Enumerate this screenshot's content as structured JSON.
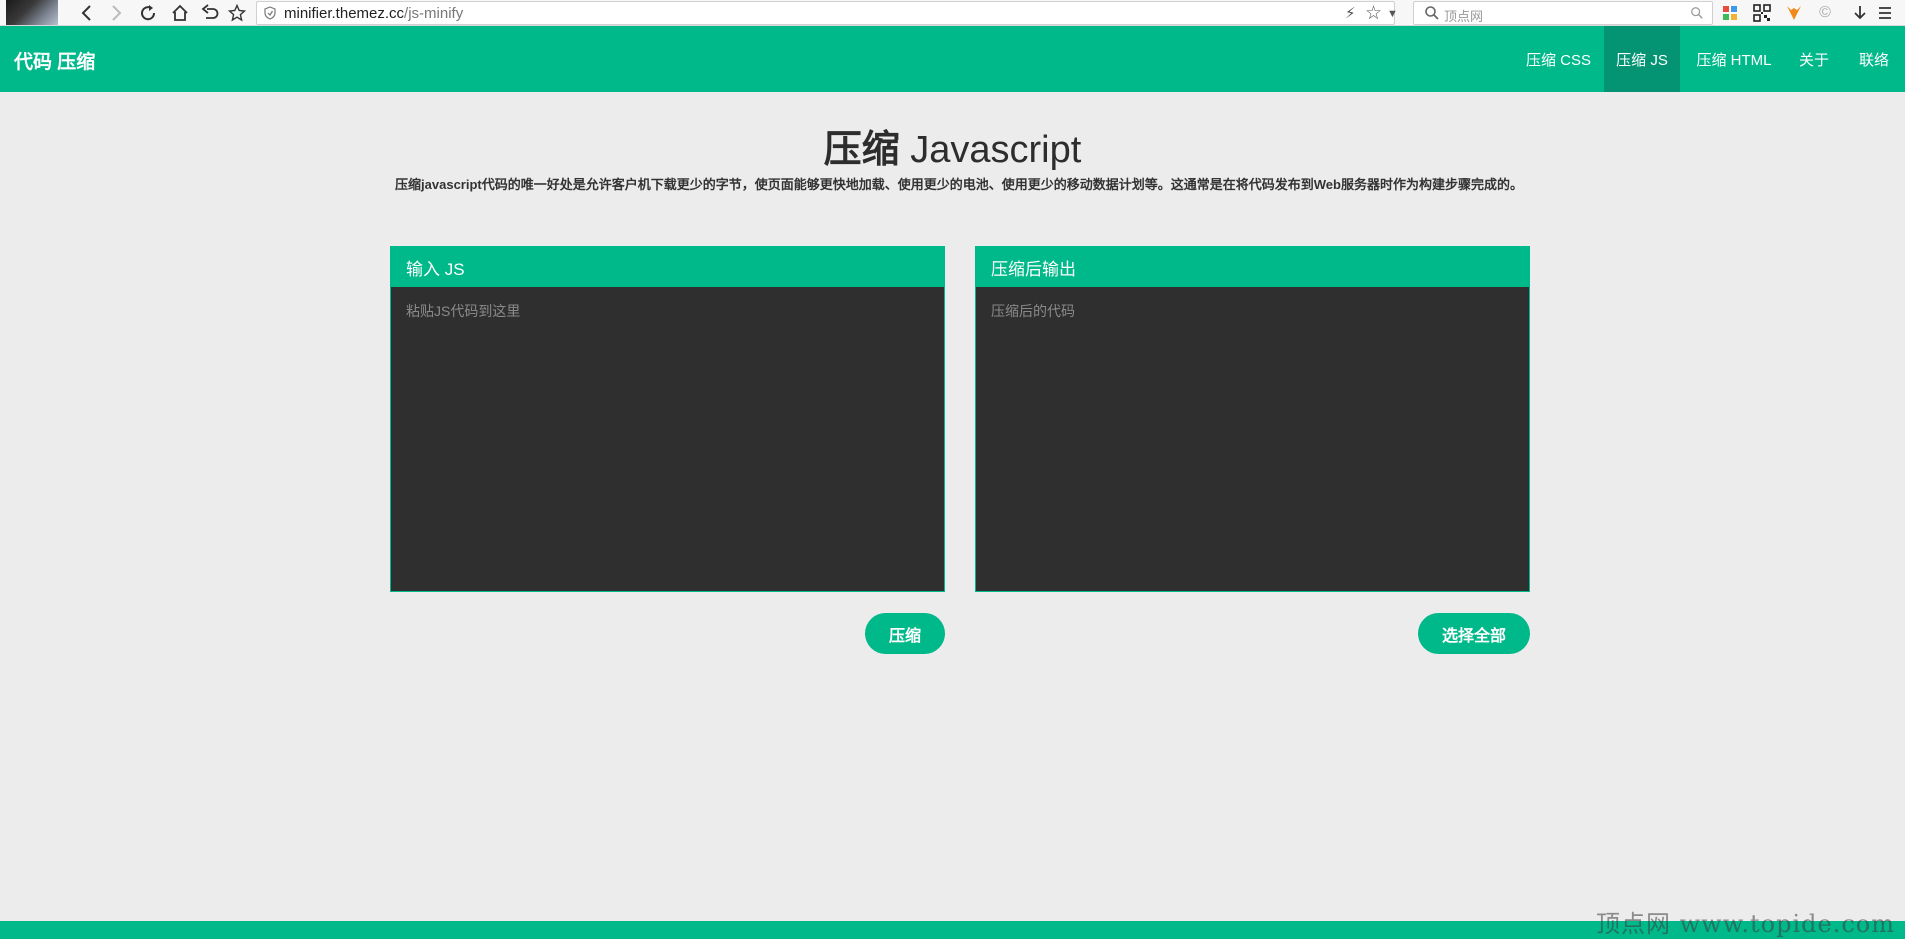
{
  "browser": {
    "url_host": "minifier.themez.cc",
    "url_path": "/js-minify",
    "search_placeholder": "顶点网"
  },
  "nav": {
    "brand": "代码 压缩",
    "items": [
      {
        "label": "压缩 CSS",
        "active": false
      },
      {
        "label": "压缩 JS",
        "active": true
      },
      {
        "label": "压缩 HTML",
        "active": false
      },
      {
        "label": "关于",
        "active": false
      },
      {
        "label": "联络",
        "active": false
      }
    ]
  },
  "page": {
    "title_bold": "压缩",
    "title_rest": " Javascript",
    "description": "压缩javascript代码的唯一好处是允许客户机下载更少的字节，使页面能够更快地加载、使用更少的电池、使用更少的移动数据计划等。这通常是在将代码发布到Web服务器时作为构建步骤完成的。"
  },
  "input_panel": {
    "title": "输入 JS",
    "placeholder": "粘贴JS代码到这里",
    "button": "压缩"
  },
  "output_panel": {
    "title": "压缩后输出",
    "placeholder": "压缩后的代码",
    "button": "选择全部"
  },
  "watermark": "顶点网 www.topide.com",
  "colors": {
    "accent": "#00b98a",
    "accent_dark": "#049473",
    "panel_bg": "#2f2f2f",
    "page_bg": "#ececec"
  }
}
